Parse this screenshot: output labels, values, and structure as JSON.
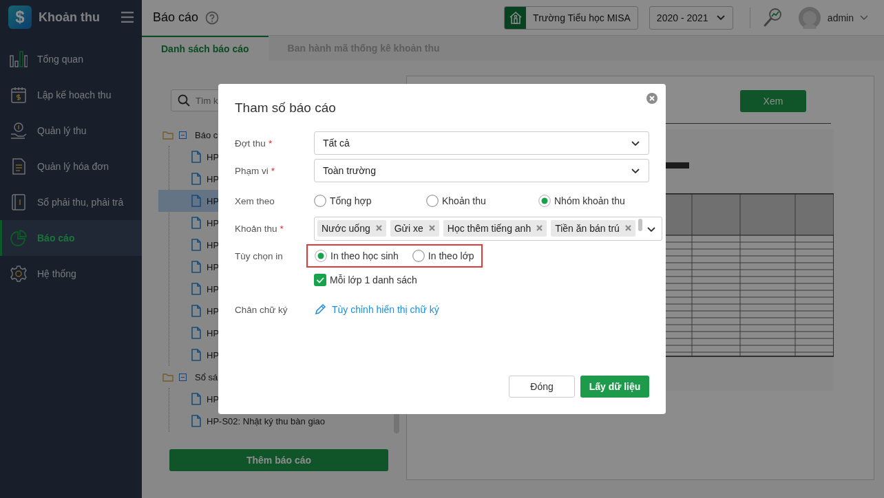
{
  "sidebar": {
    "logo_symbol": "$",
    "app_name": "Khoản thu",
    "items": [
      {
        "label": "Tổng quan",
        "selected": false
      },
      {
        "label": "Lập kế hoạch thu",
        "selected": false
      },
      {
        "label": "Quản lý thu",
        "selected": false
      },
      {
        "label": "Quản lý hóa đơn",
        "selected": false
      },
      {
        "label": "Sổ phải thu, phải trả",
        "selected": false
      },
      {
        "label": "Báo cáo",
        "selected": true
      },
      {
        "label": "Hệ thống",
        "selected": false
      }
    ]
  },
  "header": {
    "title": "Báo cáo",
    "school": "Trường Tiểu học MISA",
    "year": "2020 - 2021",
    "user": "admin"
  },
  "tabs": [
    {
      "label": "Danh sách báo cáo",
      "selected": true
    },
    {
      "label": "Ban hành mã thống kê khoản thu",
      "selected": false
    }
  ],
  "tree": {
    "search_placeholder": "Tìm k",
    "groups": [
      {
        "label": "Báo c",
        "expanded": true,
        "children": [
          {
            "label": "HP",
            "selected": false
          },
          {
            "label": "HP",
            "selected": false
          },
          {
            "label": "HP",
            "selected": true
          },
          {
            "label": "HP",
            "selected": false
          },
          {
            "label": "HP",
            "selected": false
          },
          {
            "label": "HP",
            "selected": false
          },
          {
            "label": "HP",
            "selected": false
          },
          {
            "label": "HP",
            "selected": false
          },
          {
            "label": "HP",
            "selected": false
          },
          {
            "label": "HP",
            "selected": false
          }
        ]
      },
      {
        "label": "Sổ sá",
        "expanded": true,
        "children": [
          {
            "label": "HP",
            "selected": false
          },
          {
            "label": "HP-S02: Nhật ký thu bàn giao",
            "selected": false
          }
        ]
      }
    ]
  },
  "add_button": "Thêm báo cáo",
  "preview": {
    "view_button": "Xem",
    "kind": "picture"
  },
  "dialog": {
    "title": "Tham số báo cáo",
    "fields": [
      {
        "kind": "select",
        "label": "Đợt thu",
        "required_mark": "*",
        "value": "Tất cả"
      },
      {
        "kind": "select",
        "label": "Phạm vi",
        "required_mark": "*",
        "value": "Toàn trường"
      },
      {
        "kind": "radio",
        "label": "Xem theo",
        "options": [
          {
            "label": "Tổng hợp",
            "selected": false
          },
          {
            "label": "Khoản thu",
            "selected": false
          },
          {
            "label": "Nhóm khoản thu",
            "selected": true
          }
        ]
      },
      {
        "kind": "tags",
        "label": "Khoản thu",
        "required_mark": "*",
        "tags": [
          "Nước uống",
          "Gửi xe",
          "Học thêm tiếng anh",
          "Tiền ăn bán trú"
        ]
      },
      {
        "kind": "radio",
        "label": "Tùy chọn in",
        "highlighted": true,
        "options": [
          {
            "label": "In theo học sinh",
            "selected": true
          },
          {
            "label": "In theo lớp",
            "selected": false
          }
        ]
      },
      {
        "kind": "checkbox",
        "text": "Mỗi lớp 1 danh sách",
        "checked": true
      },
      {
        "kind": "link",
        "label": "Chân chữ ký",
        "text": "Tùy chỉnh hiển thị chữ ký"
      }
    ],
    "buttons": [
      {
        "label": "Đóng",
        "kind": "secondary"
      },
      {
        "label": "Lấy dữ liệu",
        "kind": "primary"
      }
    ]
  }
}
